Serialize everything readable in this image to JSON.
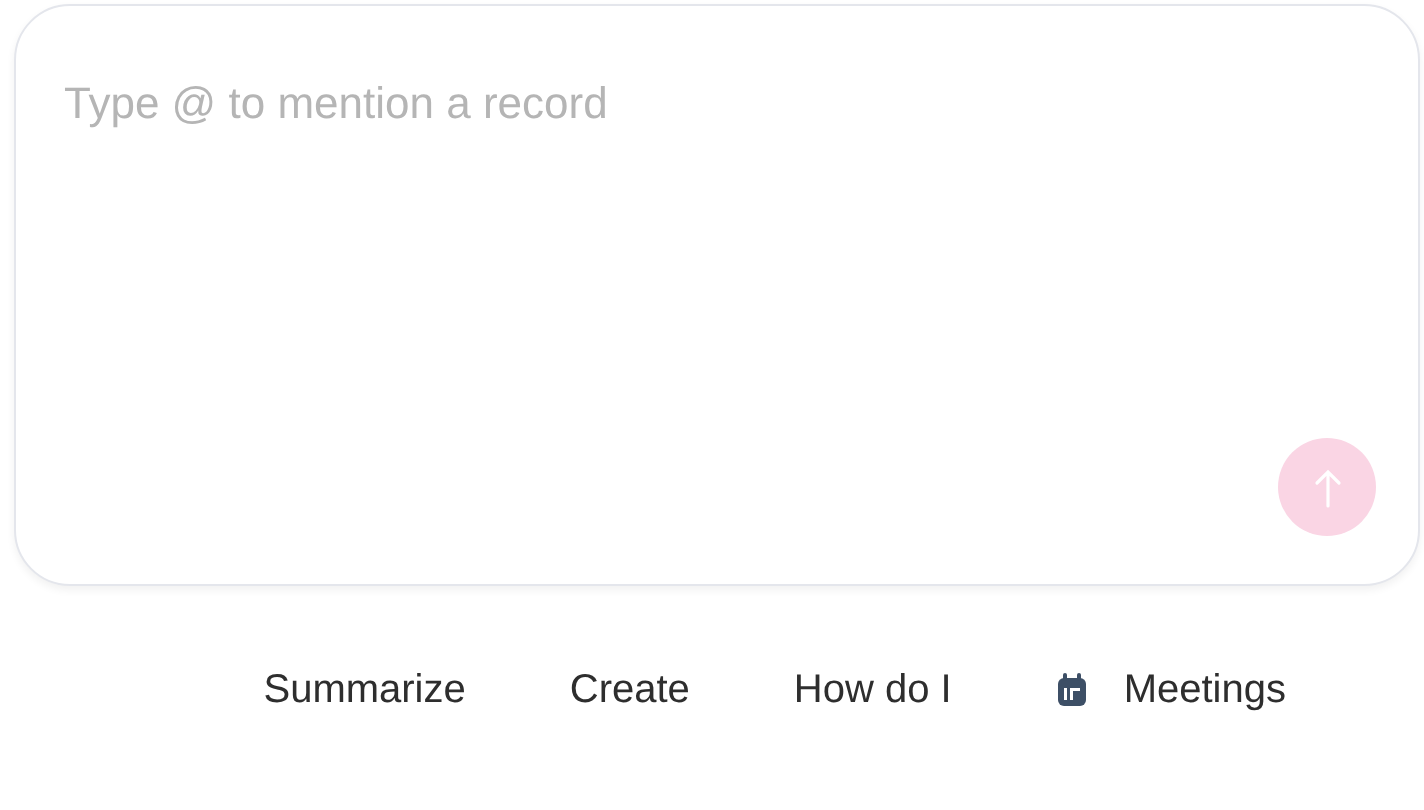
{
  "composer": {
    "placeholder": "Type @ to mention a record",
    "send_disabled": true
  },
  "suggestions": [
    {
      "label": "Summarize",
      "kind": "plain"
    },
    {
      "label": "Create",
      "kind": "plain"
    },
    {
      "label": "How do I",
      "kind": "plain"
    },
    {
      "label": "Meetings",
      "kind": "calendar"
    }
  ]
}
